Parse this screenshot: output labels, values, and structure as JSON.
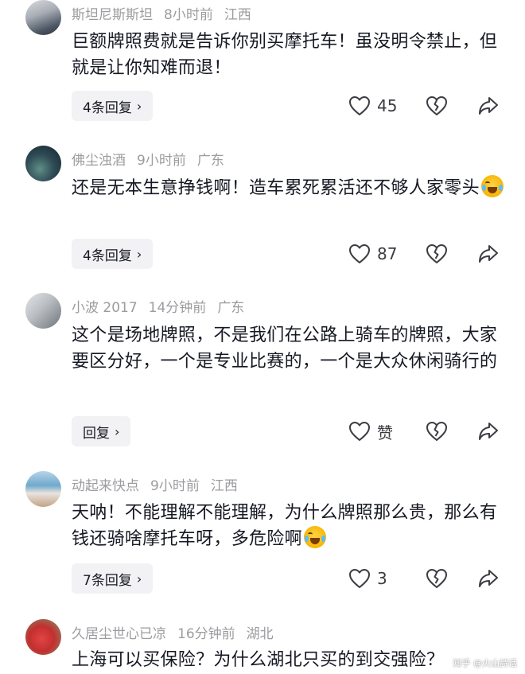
{
  "comments": [
    {
      "username": "斯坦尼斯斯坦",
      "time": "8小时前",
      "location": "江西",
      "text": "巨额牌照费就是告诉你别买摩托车！虽没明令禁止，但就是让你知难而退！",
      "reply_label": "4条回复",
      "likes": "45",
      "avatar_colors": [
        "#c9ccd2",
        "#4e5866"
      ],
      "has_emoji": false
    },
    {
      "username": "佛尘浊酒",
      "time": "9小时前",
      "location": "广东",
      "text": "还是无本生意挣钱啊！造车累死累活还不够人家零头",
      "reply_label": "4条回复",
      "likes": "87",
      "avatar_colors": [
        "#1d2c3a",
        "#3f6b6a"
      ],
      "has_emoji": true
    },
    {
      "username": "小波 2017",
      "time": "14分钟前",
      "location": "广东",
      "text": "这个是场地牌照，不是我们在公路上骑车的牌照，大家要区分好，一个是专业比赛的，一个是大众休闲骑行的",
      "reply_label": "回复",
      "likes": "赞",
      "avatar_colors": [
        "#8a8f95",
        "#d6d8db"
      ],
      "has_emoji": false
    },
    {
      "username": "动起来快点",
      "time": "9小时前",
      "location": "江西",
      "text": "天呐！不能理解不能理解，为什么牌照那么贵，那么有钱还骑啥摩托车呀，多危险啊",
      "reply_label": "7条回复",
      "likes": "3",
      "avatar_colors": [
        "#7fb8d8",
        "#c9a98a"
      ],
      "has_emoji": true
    },
    {
      "username": "久居尘世心已凉",
      "time": "16分钟前",
      "location": "湖北",
      "text": "上海可以买保险？为什么湖北只买的到交强险？",
      "avatar_colors": [
        "#d63a3a",
        "#6a8a5a"
      ]
    }
  ],
  "icons": {
    "like": "heart-outline-icon",
    "dislike": "broken-heart-icon",
    "share": "share-arrow-icon",
    "reply_chevron": "chevron-right-icon"
  },
  "watermark": "知乎 @火山詩话"
}
